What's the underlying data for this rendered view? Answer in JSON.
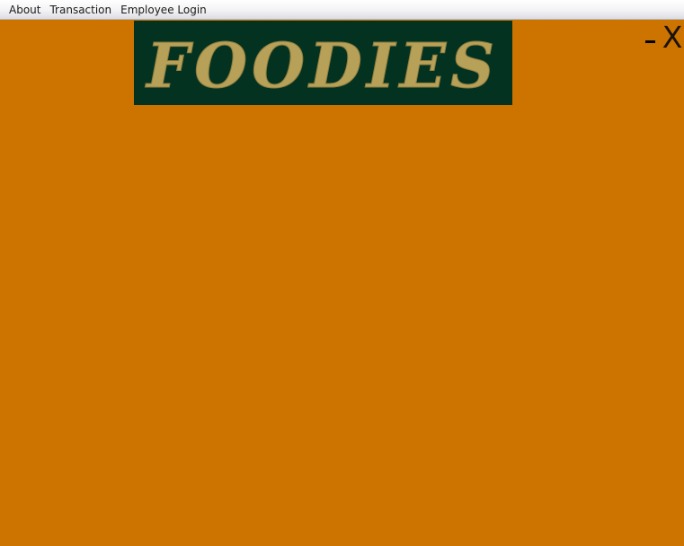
{
  "menubar": {
    "items": [
      {
        "label": "About"
      },
      {
        "label": "Transaction"
      },
      {
        "label": "Employee Login"
      }
    ]
  },
  "logo": {
    "text": "FOODIES",
    "text_color": "#b7a158",
    "background_color": "#033221"
  },
  "window_controls": {
    "minimize_label": "-",
    "close_label": "X"
  },
  "colors": {
    "background": "#cc7300",
    "menubar": "#f3f3f5"
  }
}
